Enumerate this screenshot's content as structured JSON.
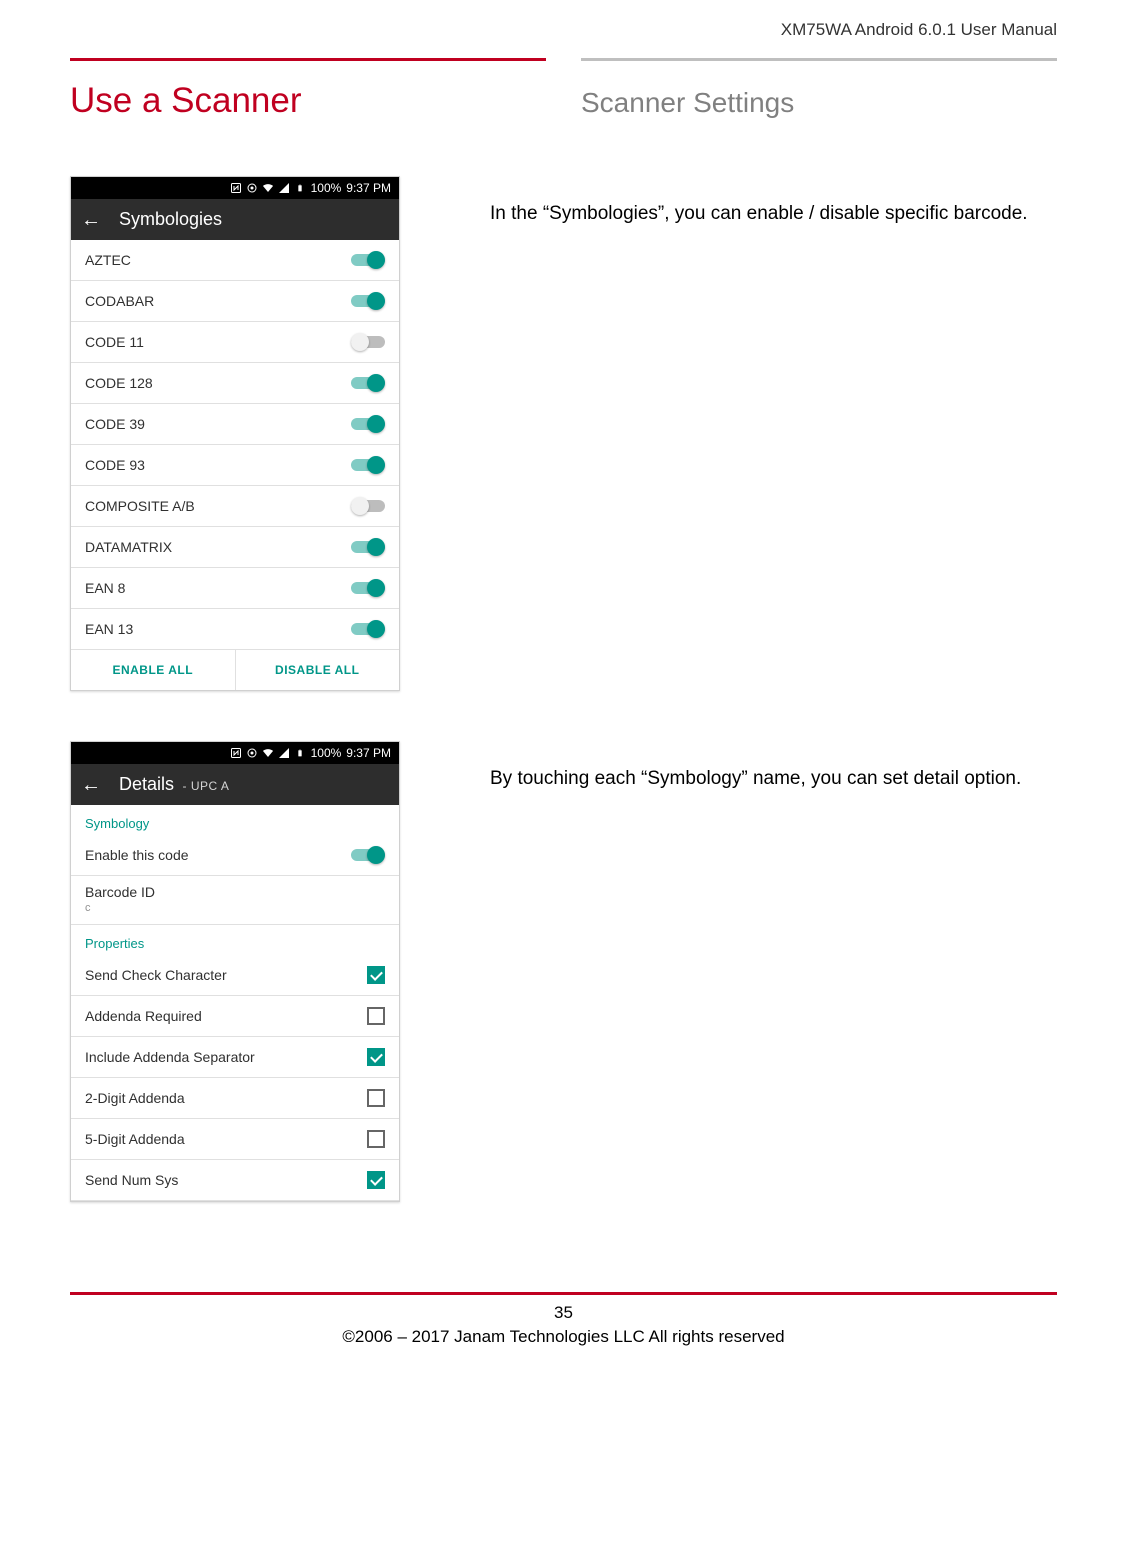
{
  "doc": {
    "header": "XM75WA Android 6.0.1 User Manual",
    "title_left": "Use a Scanner",
    "title_right": "Scanner Settings",
    "footer_page": "35",
    "footer_copy": "©2006 – 2017 Janam Technologies LLC All rights reserved"
  },
  "para1": "In the “Symbologies”, you can enable / disable specific barcode.",
  "para2": "By touching each “Symbology” name, you can set detail option.",
  "status": {
    "battery": "100%",
    "time": "9:37 PM"
  },
  "screen1": {
    "title": "Symbologies",
    "items": [
      {
        "label": "AZTEC",
        "on": true
      },
      {
        "label": "CODABAR",
        "on": true
      },
      {
        "label": "CODE 11",
        "on": false
      },
      {
        "label": "CODE 128",
        "on": true
      },
      {
        "label": "CODE 39",
        "on": true
      },
      {
        "label": "CODE 93",
        "on": true
      },
      {
        "label": "COMPOSITE A/B",
        "on": false
      },
      {
        "label": "DATAMATRIX",
        "on": true
      },
      {
        "label": "EAN 8",
        "on": true
      },
      {
        "label": "EAN 13",
        "on": true
      }
    ],
    "enable_all": "ENABLE ALL",
    "disable_all": "DISABLE ALL"
  },
  "screen2": {
    "title": "Details",
    "subtitle": "- UPC A",
    "section1": "Symbology",
    "enable_label": "Enable this code",
    "enable_on": true,
    "barcode_id_label": "Barcode ID",
    "barcode_id_value": "c",
    "section2": "Properties",
    "props": [
      {
        "label": "Send Check Character",
        "checked": true
      },
      {
        "label": "Addenda Required",
        "checked": false
      },
      {
        "label": "Include Addenda Separator",
        "checked": true
      },
      {
        "label": "2-Digit Addenda",
        "checked": false
      },
      {
        "label": "5-Digit Addenda",
        "checked": false
      },
      {
        "label": "Send Num Sys",
        "checked": true
      }
    ]
  }
}
